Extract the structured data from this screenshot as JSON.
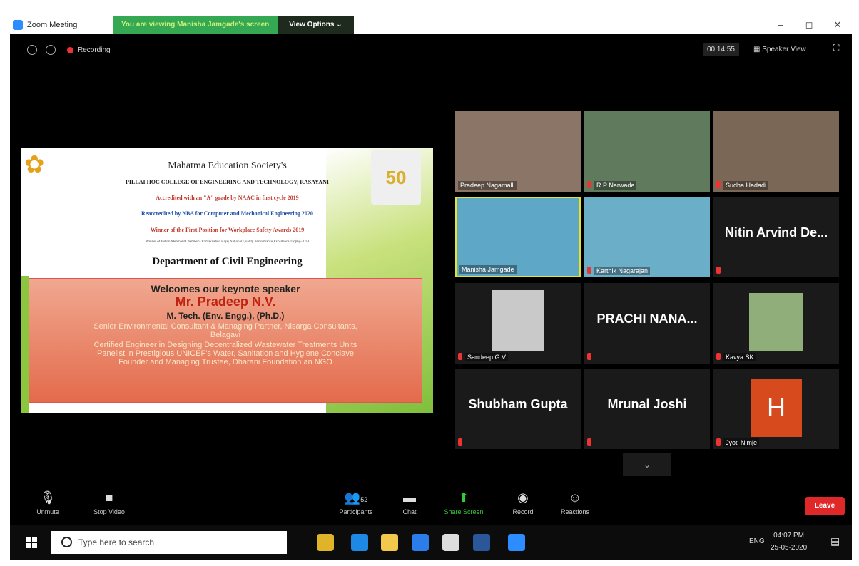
{
  "window": {
    "title": "Zoom Meeting",
    "banner": "You are viewing Manisha Jamgade's screen",
    "view_options": "View Options ⌄",
    "controls": [
      "–",
      "◻",
      "✕"
    ]
  },
  "topbar": {
    "recording_label": "Recording",
    "timer": "00:14:55",
    "speaker_view": "Speaker View"
  },
  "slide": {
    "society": "Mahatma Education Society's",
    "college": "PILLAI HOC COLLEGE OF ENGINEERING AND TECHNOLOGY, RASAYANI",
    "naac": "Accredited with an \"A\" grade by NAAC in first cycle 2019",
    "nba": "Reaccredited by NBA for Computer and Mechanical Engineering 2020",
    "award": "Winner of the First Position for Workplace Safety Awards 2019",
    "trophy": "Winner of Indian Merchant Chamber's Ramakrishna Bajaj National Quality Performance Excellence Trophy-2019",
    "department": "Department of Civil Engineering",
    "welcome": "Welcomes our keynote speaker",
    "speaker": "Mr. Pradeep N.V.",
    "degree": "M. Tech. (Env. Engg.), (Ph.D.)",
    "line1": "Senior Environmental Consultant & Managing Partner, Nisarga Consultants,",
    "line2": "Belagavi",
    "line3": "Certified Engineer in Designing Decentralized Wastewater Treatments Units",
    "line4": "Panelist in Prestigious UNICEF's Water, Sanitation and Hygiene Conclave",
    "line5": "Founder and Managing Trustee, Dharani Foundation an NGO"
  },
  "participants_grid": [
    {
      "name": "Pradeep Nagamalli",
      "big": ""
    },
    {
      "name": "R P Narwade",
      "big": ""
    },
    {
      "name": "Sudha Hadadi",
      "big": ""
    },
    {
      "name": "Manisha Jamgade",
      "big": ""
    },
    {
      "name": "Karthik Nagarajan",
      "big": ""
    },
    {
      "name": "",
      "big": "Nitin Arvind De..."
    },
    {
      "name": "Sandeep G V",
      "big": ""
    },
    {
      "name": "",
      "big": "PRACHI NANA..."
    },
    {
      "name": "Kavya SK",
      "big": ""
    },
    {
      "name": "",
      "big": "Shubham Gupta"
    },
    {
      "name": "",
      "big": "Mrunal Joshi"
    },
    {
      "name": "Jyoti Nimje",
      "big": "H"
    }
  ],
  "toolbar": {
    "unmute": "Unmute",
    "stop_video": "Stop Video",
    "participants": "Participants",
    "participants_count": "52",
    "chat": "Chat",
    "share_screen": "Share Screen",
    "record": "Record",
    "reactions": "Reactions",
    "leave": "Leave"
  },
  "taskbar": {
    "search_placeholder": "Type here to search",
    "lang": "ENG",
    "time": "04:07 PM",
    "date": "25-05-2020"
  }
}
